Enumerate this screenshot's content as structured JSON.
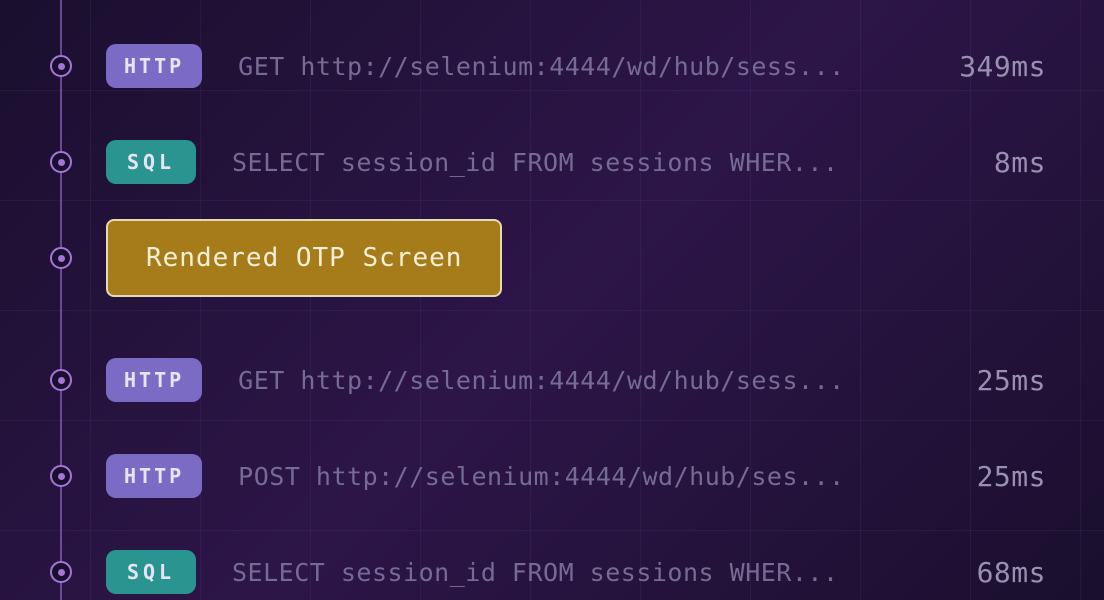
{
  "timeline": [
    {
      "type": "log",
      "badge_type": "http",
      "badge_label": "HTTP",
      "description": "GET http://selenium:4444/wd/hub/sess...",
      "timing": "349ms"
    },
    {
      "type": "log",
      "badge_type": "sql",
      "badge_label": "SQL",
      "description": "SELECT session_id FROM sessions WHER...",
      "timing": "8ms"
    },
    {
      "type": "event",
      "event_label": "Rendered OTP Screen"
    },
    {
      "type": "log",
      "badge_type": "http",
      "badge_label": "HTTP",
      "description": "GET http://selenium:4444/wd/hub/sess...",
      "timing": "25ms"
    },
    {
      "type": "log",
      "badge_type": "http",
      "badge_label": "HTTP",
      "description": "POST http://selenium:4444/wd/hub/ses...",
      "timing": "25ms"
    },
    {
      "type": "log",
      "badge_type": "sql",
      "badge_label": "SQL",
      "description": "SELECT session_id FROM sessions WHER...",
      "timing": "68ms"
    }
  ]
}
